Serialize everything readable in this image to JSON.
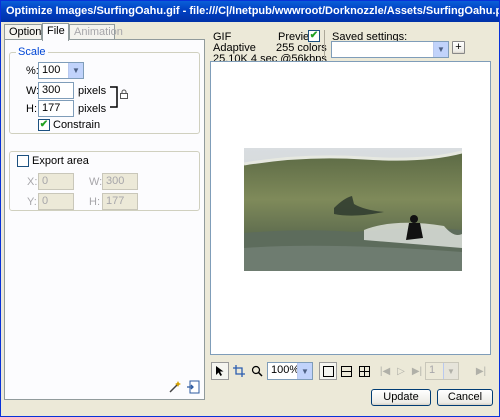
{
  "window": {
    "title": "Optimize Images/SurfingOahu.gif - file:///C|/Inetpub/wwwroot/Dorknozzle/Assets/SurfingOahu.png"
  },
  "tabs": [
    {
      "label": "Options",
      "state": "normal"
    },
    {
      "label": "File",
      "state": "active"
    },
    {
      "label": "Animation",
      "state": "disabled"
    }
  ],
  "scale": {
    "group_label": "Scale",
    "percent_label": "%:",
    "percent_value": "100",
    "width_label": "W:",
    "width_value": "300",
    "width_unit": "pixels",
    "height_label": "H:",
    "height_value": "177",
    "height_unit": "pixels",
    "constrain_label": "Constrain",
    "constrain_checked": true
  },
  "export_area": {
    "label": "Export area",
    "checked": false,
    "x_label": "X:",
    "x_value": "0",
    "y_label": "Y:",
    "y_value": "0",
    "w_label": "W:",
    "w_value": "300",
    "h_label": "H:",
    "h_value": "177"
  },
  "info": {
    "format": "GIF",
    "palette": "Adaptive",
    "size_time": "25.10K  4 sec @56kbps",
    "preview_label": "Preview",
    "preview_checked": true,
    "colors": "255 colors"
  },
  "saved_settings": {
    "label": "Saved settings:",
    "value": "",
    "add_label": "+"
  },
  "toolbar": {
    "zoom_value": "100%",
    "frame_value": "1"
  },
  "buttons": {
    "update_label": "Update",
    "cancel_label": "Cancel"
  },
  "colors": {
    "titlebar": "#0054e3",
    "face": "#ece9d8",
    "check": "#21a121"
  }
}
